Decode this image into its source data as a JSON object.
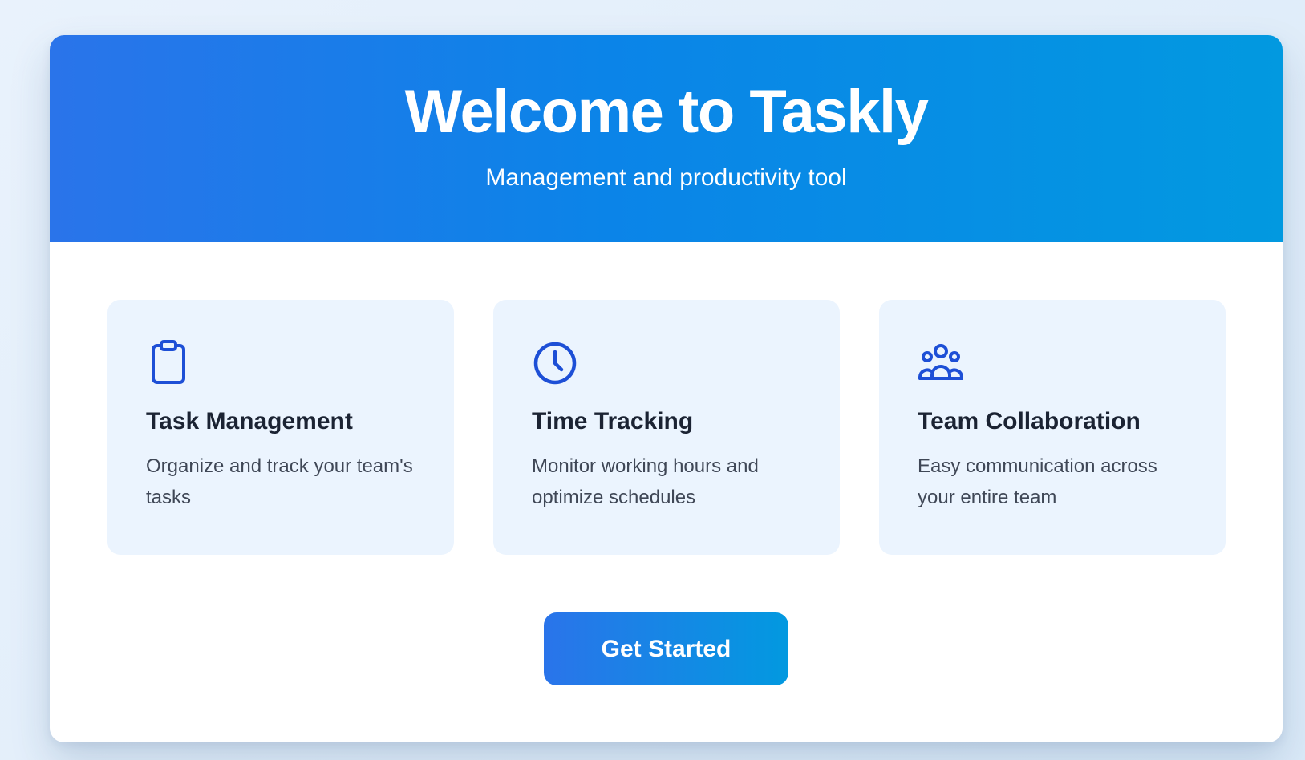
{
  "hero": {
    "title": "Welcome to Taskly",
    "subtitle": "Management and productivity tool"
  },
  "features": [
    {
      "icon": "clipboard-icon",
      "title": "Task Management",
      "description": "Organize and track your team's tasks"
    },
    {
      "icon": "clock-icon",
      "title": "Time Tracking",
      "description": "Monitor working hours and optimize schedules"
    },
    {
      "icon": "team-icon",
      "title": "Team Collaboration",
      "description": "Easy communication across your entire team"
    }
  ],
  "cta": {
    "label": "Get Started"
  },
  "colors": {
    "primary": "#2a74ea",
    "secondary": "#0299e0",
    "icon": "#1d4fd6",
    "feature_card_bg": "#ebf4fe",
    "heading_text": "#1b2333",
    "body_text": "#3f4756",
    "page_bg": "#e5effa"
  }
}
